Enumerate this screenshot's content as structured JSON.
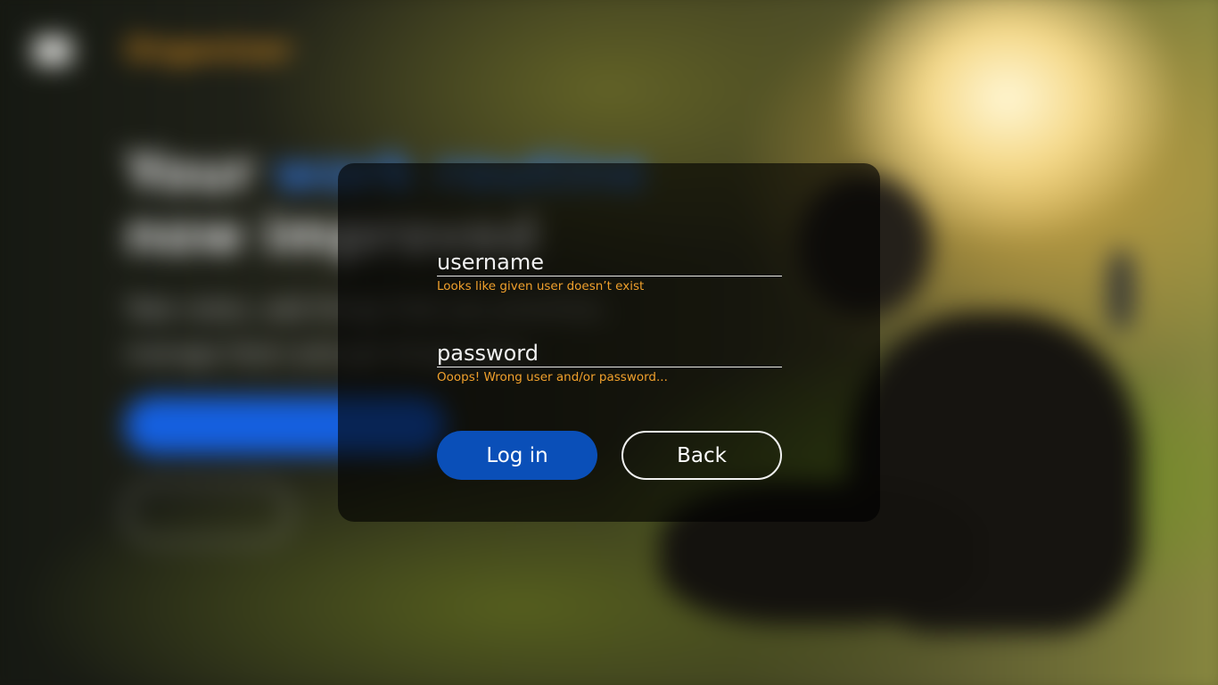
{
  "background": {
    "brand_prefix": "Organi",
    "brand_accent": "zer",
    "headline_plain_1": "Your ",
    "headline_accent": "work routine",
    "headline_line_2": "now improved",
    "subtitle": "Take notes, add things that you prioritize, manage them and get things done",
    "create_account_label": "Create account for free",
    "login_label": "Log in"
  },
  "login_form": {
    "username": {
      "value": "",
      "placeholder": "username",
      "error": "Looks like given user doesn’t exist"
    },
    "password": {
      "value": "",
      "placeholder": "password",
      "error": "Ooops! Wrong user and/or password..."
    },
    "login_button_label": "Log in",
    "back_button_label": "Back"
  },
  "colors": {
    "primary_button": "#0a4fb8",
    "error_text": "#f0a02c",
    "modal_background": "rgba(0,0,0,0.62)"
  }
}
